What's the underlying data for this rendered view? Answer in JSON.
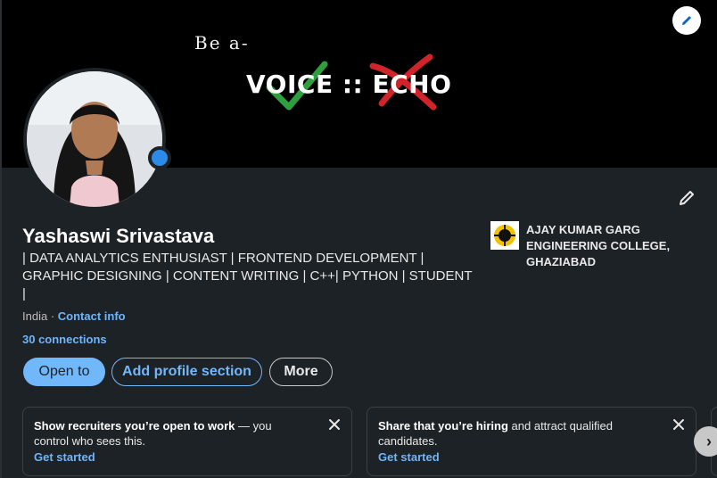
{
  "banner": {
    "tagline": "Be a-",
    "title": "VOICE :: ECHO"
  },
  "profile": {
    "name": "Yashaswi Srivastava",
    "headline": "| DATA ANALYTICS ENTHUSIAST | FRONTEND DEVELOPMENT | GRAPHIC DESIGNING | CONTENT WRITING | C++| PYTHON | STUDENT |",
    "location": "India",
    "location_separator": " · ",
    "contact_info": "Contact info",
    "connections": "30 connections"
  },
  "actions": {
    "open_to": "Open to",
    "add_section": "Add profile section",
    "more": "More"
  },
  "education": {
    "name": "AJAY KUMAR GARG ENGINEERING COLLEGE, GHAZIABAD"
  },
  "promos": [
    {
      "bold": "Show recruiters you’re open to work",
      "rest": " — you control who sees this.",
      "link": "Get started"
    },
    {
      "bold": "Share that you’re hiring",
      "rest": " and attract qualified candidates.",
      "link": "Get started"
    }
  ],
  "icons": {
    "banner_edit": "pencil-icon",
    "section_edit": "pencil-icon",
    "close": "close-icon",
    "carousel_next": "chevron-right-icon"
  },
  "colors": {
    "accent": "#71b7fb",
    "card_bg": "#1d2226",
    "banner_bg": "#000000",
    "check_green": "#2e9e3e",
    "cross_red": "#d0232a"
  }
}
